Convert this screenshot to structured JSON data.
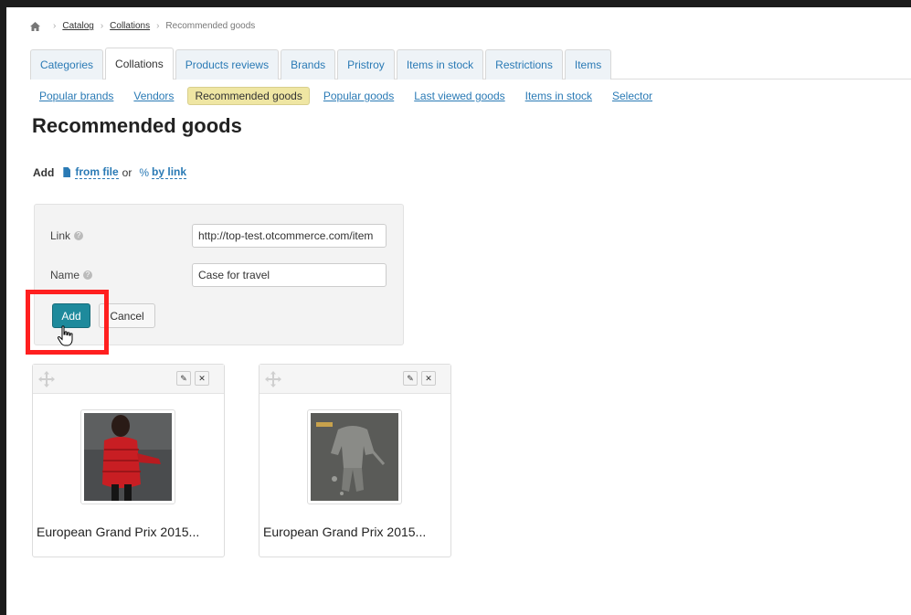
{
  "breadcrumb": {
    "items": [
      "Catalog",
      "Collations"
    ],
    "current": "Recommended goods"
  },
  "tabs": [
    {
      "label": "Categories",
      "active": false
    },
    {
      "label": "Collations",
      "active": true
    },
    {
      "label": "Products reviews",
      "active": false
    },
    {
      "label": "Brands",
      "active": false
    },
    {
      "label": "Pristroy",
      "active": false
    },
    {
      "label": "Items in stock",
      "active": false
    },
    {
      "label": "Restrictions",
      "active": false
    },
    {
      "label": "Items",
      "active": false
    }
  ],
  "subnav": [
    {
      "label": "Popular brands",
      "active": false
    },
    {
      "label": "Vendors",
      "active": false
    },
    {
      "label": "Recommended goods",
      "active": true
    },
    {
      "label": "Popular goods",
      "active": false
    },
    {
      "label": "Last viewed goods",
      "active": false
    },
    {
      "label": "Items in stock",
      "active": false
    },
    {
      "label": "Selector",
      "active": false
    }
  ],
  "page_title": "Recommended goods",
  "add_line": {
    "prefix": "Add",
    "from_file": "from file",
    "or": "or",
    "by_link": "by link"
  },
  "form": {
    "link_label": "Link",
    "link_value": "http://top-test.otcommerce.com/item",
    "name_label": "Name",
    "name_value": "Case for travel",
    "add_button": "Add",
    "cancel_button": "Cancel"
  },
  "products": [
    {
      "title": "European Grand Prix 2015..."
    },
    {
      "title": "European Grand Prix 2015..."
    }
  ],
  "colors": {
    "link": "#2a7ab5",
    "primary_button": "#1e8a9c",
    "highlight": "#ff1f1f",
    "active_subnav": "#efe6a3"
  }
}
